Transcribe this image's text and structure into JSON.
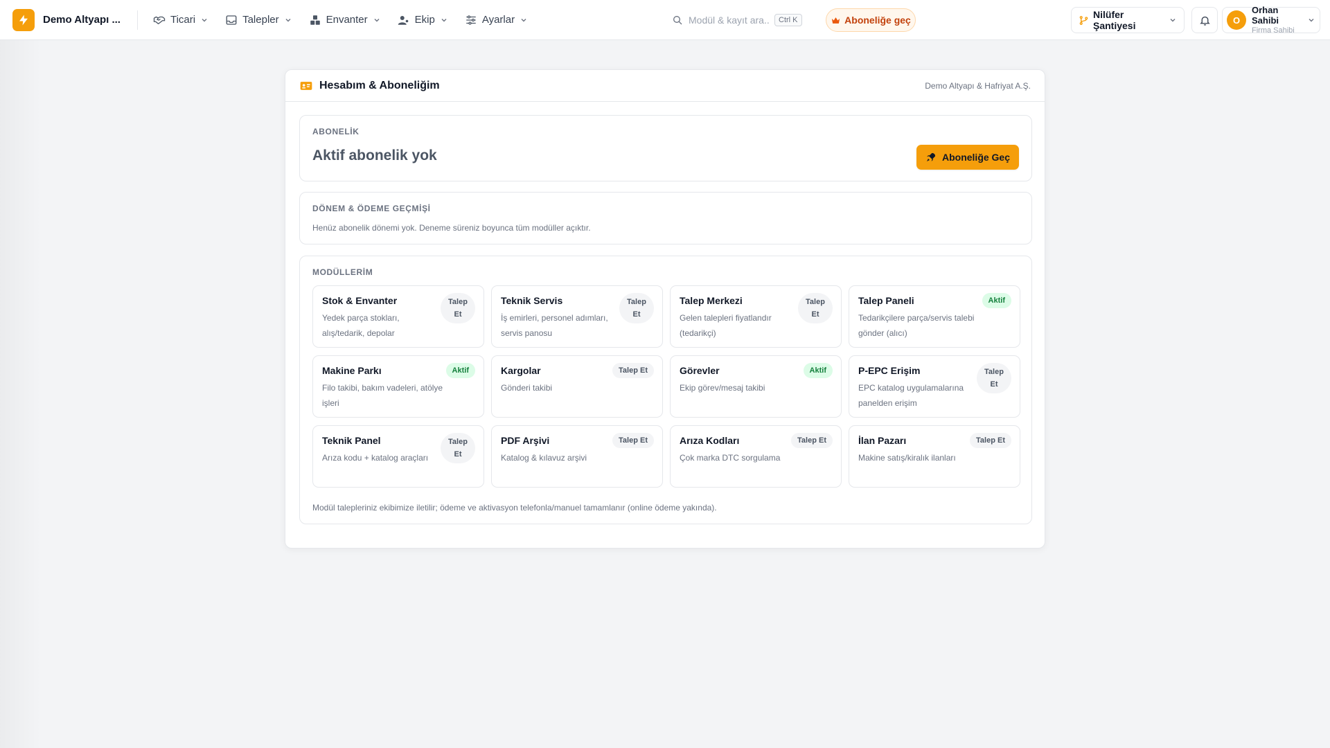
{
  "app": {
    "brand_name": "Demo Altyapı ...",
    "accent_color": "#f59e0b"
  },
  "nav": [
    {
      "label": "Ticari",
      "icon": "handshake-icon"
    },
    {
      "label": "Talepler",
      "icon": "inbox-icon"
    },
    {
      "label": "Envanter",
      "icon": "boxes-icon"
    },
    {
      "label": "Ekip",
      "icon": "users-icon"
    },
    {
      "label": "Ayarlar",
      "icon": "sliders-icon"
    }
  ],
  "search": {
    "placeholder": "Modül & kayıt ara...",
    "shortcut": "Ctrl K"
  },
  "upgrade_pill": {
    "label": "Aboneliğe geç"
  },
  "site_select": {
    "label": "Nilüfer Şantiyesi"
  },
  "user": {
    "initial": "O",
    "name": "Orhan Sahibi",
    "role": "Firma Sahibi"
  },
  "card": {
    "title": "Hesabım & Aboneliğim",
    "company": "Demo Altyapı & Hafriyat A.Ş."
  },
  "subscription": {
    "label": "ABONELİK",
    "status": "Aktif abonelik yok",
    "button": "Aboneliğe Geç"
  },
  "history": {
    "label": "DÖNEM & ÖDEME GEÇMİŞİ",
    "text": "Henüz abonelik dönemi yok. Deneme süreniz boyunca tüm modüller açıktır."
  },
  "modules": {
    "label": "MODÜLLERİM",
    "note": "Modül talepleriniz ekibimize iletilir; ödeme ve aktivasyon telefonla/manuel tamamlanır (online ödeme yakında).",
    "items": [
      {
        "title": "Stok & Envanter",
        "desc": "Yedek parça stokları, alış/tedarik, depolar",
        "badge": "Talep Et",
        "status": "request",
        "wrap": true
      },
      {
        "title": "Teknik Servis",
        "desc": "İş emirleri, personel adımları, servis panosu",
        "badge": "Talep Et",
        "status": "request",
        "wrap": true
      },
      {
        "title": "Talep Merkezi",
        "desc": "Gelen talepleri fiyatlandır (tedarikçi)",
        "badge": "Talep Et",
        "status": "request",
        "wrap": true
      },
      {
        "title": "Talep Paneli",
        "desc": "Tedarikçilere parça/servis talebi gönder (alıcı)",
        "badge": "Aktif",
        "status": "active",
        "wrap": false
      },
      {
        "title": "Makine Parkı",
        "desc": "Filo takibi, bakım vadeleri, atölye işleri",
        "badge": "Aktif",
        "status": "active",
        "wrap": false
      },
      {
        "title": "Kargolar",
        "desc": "Gönderi takibi",
        "badge": "Talep Et",
        "status": "request",
        "wrap": false
      },
      {
        "title": "Görevler",
        "desc": "Ekip görev/mesaj takibi",
        "badge": "Aktif",
        "status": "active",
        "wrap": false
      },
      {
        "title": "P-EPC Erişim",
        "desc": "EPC katalog uygulamalarına panelden erişim",
        "badge": "Talep Et",
        "status": "request",
        "wrap": true
      },
      {
        "title": "Teknik Panel",
        "desc": "Arıza kodu + katalog araçları",
        "badge": "Talep Et",
        "status": "request",
        "wrap": true
      },
      {
        "title": "PDF Arşivi",
        "desc": "Katalog & kılavuz arşivi",
        "badge": "Talep Et",
        "status": "request",
        "wrap": false
      },
      {
        "title": "Arıza Kodları",
        "desc": "Çok marka DTC sorgulama",
        "badge": "Talep Et",
        "status": "request",
        "wrap": false
      },
      {
        "title": "İlan Pazarı",
        "desc": "Makine satış/kiralık ilanları",
        "badge": "Talep Et",
        "status": "request",
        "wrap": false
      }
    ]
  }
}
